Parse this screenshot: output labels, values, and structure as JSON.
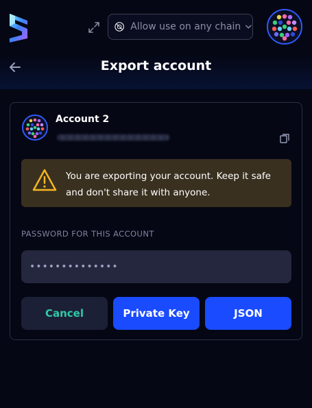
{
  "app": {
    "logo_icon": "subwallet-logo-icon",
    "expand_icon": "expand-icon",
    "chain_selector": {
      "icon": "globe-icon",
      "label": "Allow use on any chain",
      "chevron": "chevron-down-icon"
    },
    "avatar_icon": "account-avatar-icon"
  },
  "header": {
    "back_icon": "arrow-left-icon",
    "title": "Export account"
  },
  "account": {
    "name": "Account 2",
    "address_blurred": true,
    "copy_icon": "copy-icon"
  },
  "warning": {
    "icon": "warning-triangle-icon",
    "text": "You are exporting your account. Keep it safe and don't share it with anyone."
  },
  "password": {
    "label": "PASSWORD FOR THIS ACCOUNT",
    "value": "••••••••••••••"
  },
  "actions": {
    "cancel_label": "Cancel",
    "private_key_label": "Private Key",
    "json_label": "JSON"
  },
  "colors": {
    "background": "#050714",
    "primary": "#1a4bff",
    "accent_green": "#30c9a7",
    "warning_bg": "#3a3020",
    "warning_icon": "#f5b622",
    "input_bg": "#24273d"
  }
}
